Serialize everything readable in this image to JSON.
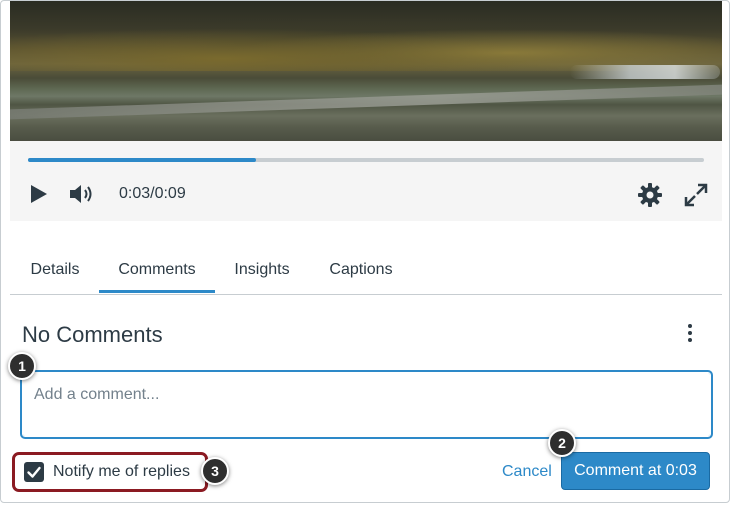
{
  "player": {
    "progress_fraction": 0.337,
    "time_display": "0:03/0:09",
    "icons": [
      "play-icon",
      "volume-icon",
      "gear-icon",
      "fullscreen-icon"
    ]
  },
  "tabs": [
    {
      "label": "Details",
      "active": false
    },
    {
      "label": "Comments",
      "active": true
    },
    {
      "label": "Insights",
      "active": false
    },
    {
      "label": "Captions",
      "active": false
    }
  ],
  "comments": {
    "heading": "No Comments",
    "input_placeholder": "Add a comment...",
    "notify_label": "Notify me of replies",
    "notify_checked": true,
    "cancel_label": "Cancel",
    "submit_label": "Comment at 0:03"
  },
  "markers": [
    "1",
    "2",
    "3"
  ],
  "colors": {
    "accent": "#2d89c8",
    "text": "#2d3b45",
    "highlight_border": "#8b1a22"
  }
}
